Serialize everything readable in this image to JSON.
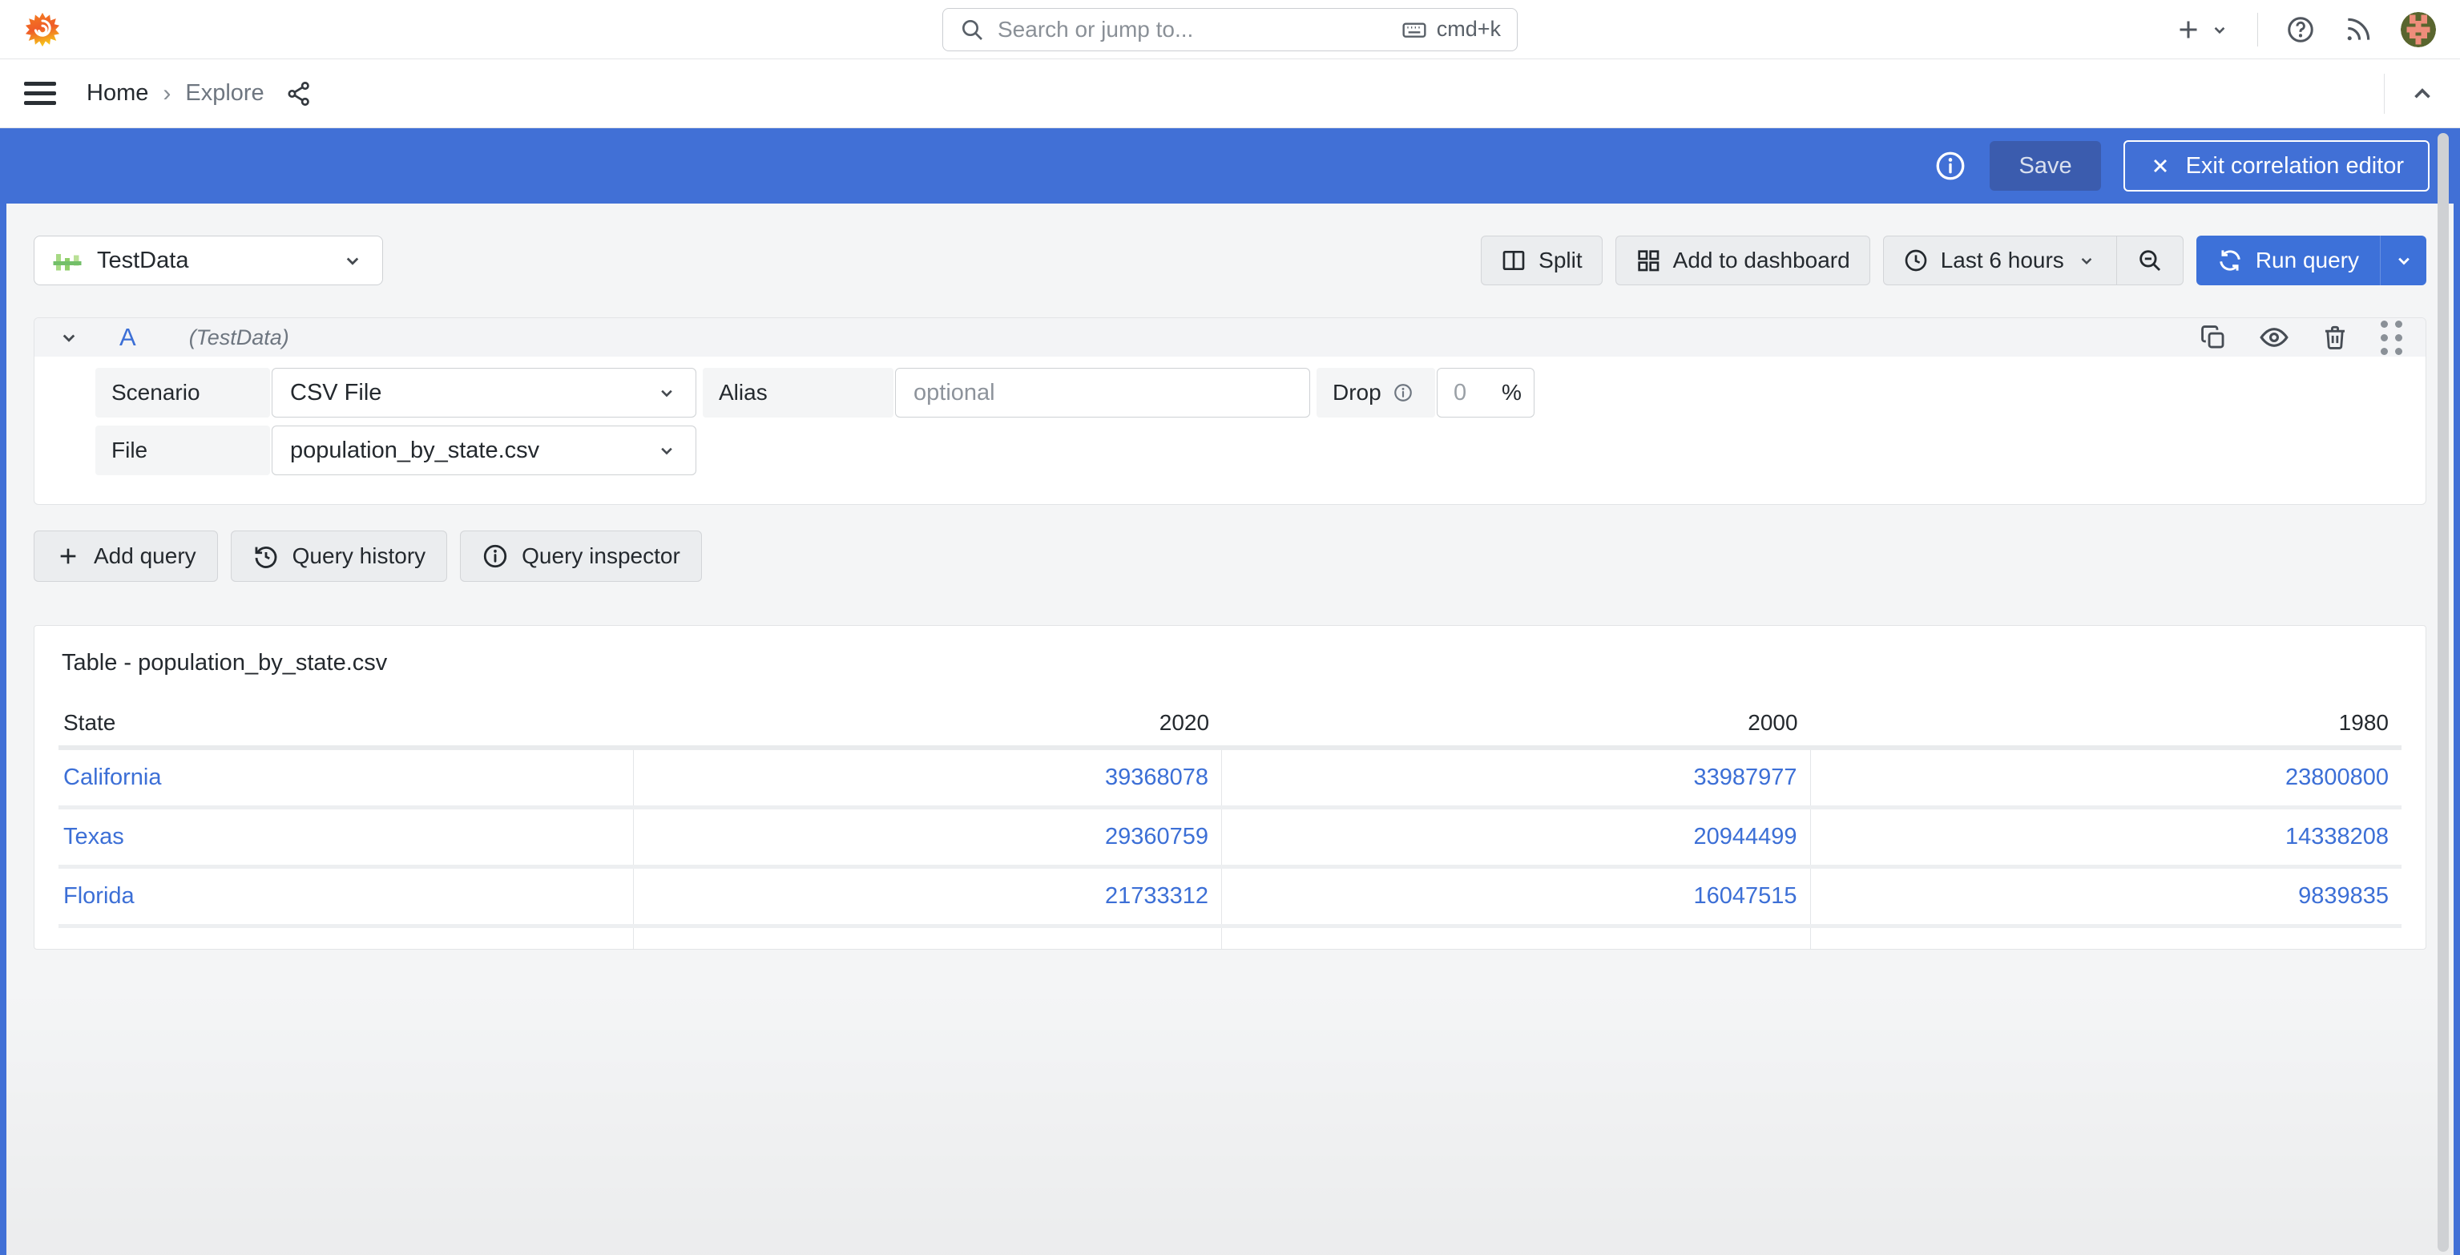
{
  "colors": {
    "accent": "#3d71d9",
    "banner": "#4170d6",
    "link": "#3c6fd6",
    "text": "#24292e",
    "secondary_text": "#6e7680",
    "datasource_icon_green": "#73bf69"
  },
  "icons": {
    "grafana-logo": "flame-spiral",
    "search": "magnifier",
    "keyboard": "keyboard",
    "new": "plus-chevron",
    "help": "question-circle",
    "news": "rss",
    "avatar": "pixel-art-avatar",
    "menu": "hamburger",
    "share": "share-nodes",
    "collapse": "chevron-up",
    "info": "info-circle",
    "close": "x",
    "split": "columns",
    "apps": "grid-squares",
    "clock": "clock",
    "zoom-out": "magnifier-minus",
    "sync": "circular-arrows",
    "dropdown": "chevron-down",
    "copy": "duplicate",
    "eye": "eye",
    "trash": "trash-can",
    "drag": "grip-dots",
    "history": "clock-rewind"
  },
  "topnav": {
    "search_placeholder": "Search or jump to...",
    "search_shortcut": "cmd+k"
  },
  "breadcrumb": {
    "home": "Home",
    "separator": "›",
    "current": "Explore"
  },
  "banner": {
    "save": "Save",
    "exit": "Exit correlation editor"
  },
  "toolbar": {
    "datasource": "TestData",
    "split": "Split",
    "add_to_dashboard": "Add to dashboard",
    "time_range": "Last 6 hours",
    "run_query": "Run query"
  },
  "query": {
    "ref_id": "A",
    "datasource_hint": "(TestData)",
    "scenario_label": "Scenario",
    "scenario_value": "CSV File",
    "alias_label": "Alias",
    "alias_placeholder": "optional",
    "drop_label": "Drop",
    "drop_value": "0",
    "drop_unit": "%",
    "file_label": "File",
    "file_value": "population_by_state.csv"
  },
  "actions": {
    "add_query": "Add query",
    "query_history": "Query history",
    "query_inspector": "Query inspector"
  },
  "panel": {
    "title": "Table - population_by_state.csv"
  },
  "chart_data": {
    "type": "table",
    "title": "Table - population_by_state.csv",
    "columns": [
      "State",
      "2020",
      "2000",
      "1980"
    ],
    "rows": [
      [
        "California",
        39368078,
        33987977,
        23800800
      ],
      [
        "Texas",
        29360759,
        20944499,
        14338208
      ],
      [
        "Florida",
        21733312,
        16047515,
        9839835
      ]
    ]
  }
}
